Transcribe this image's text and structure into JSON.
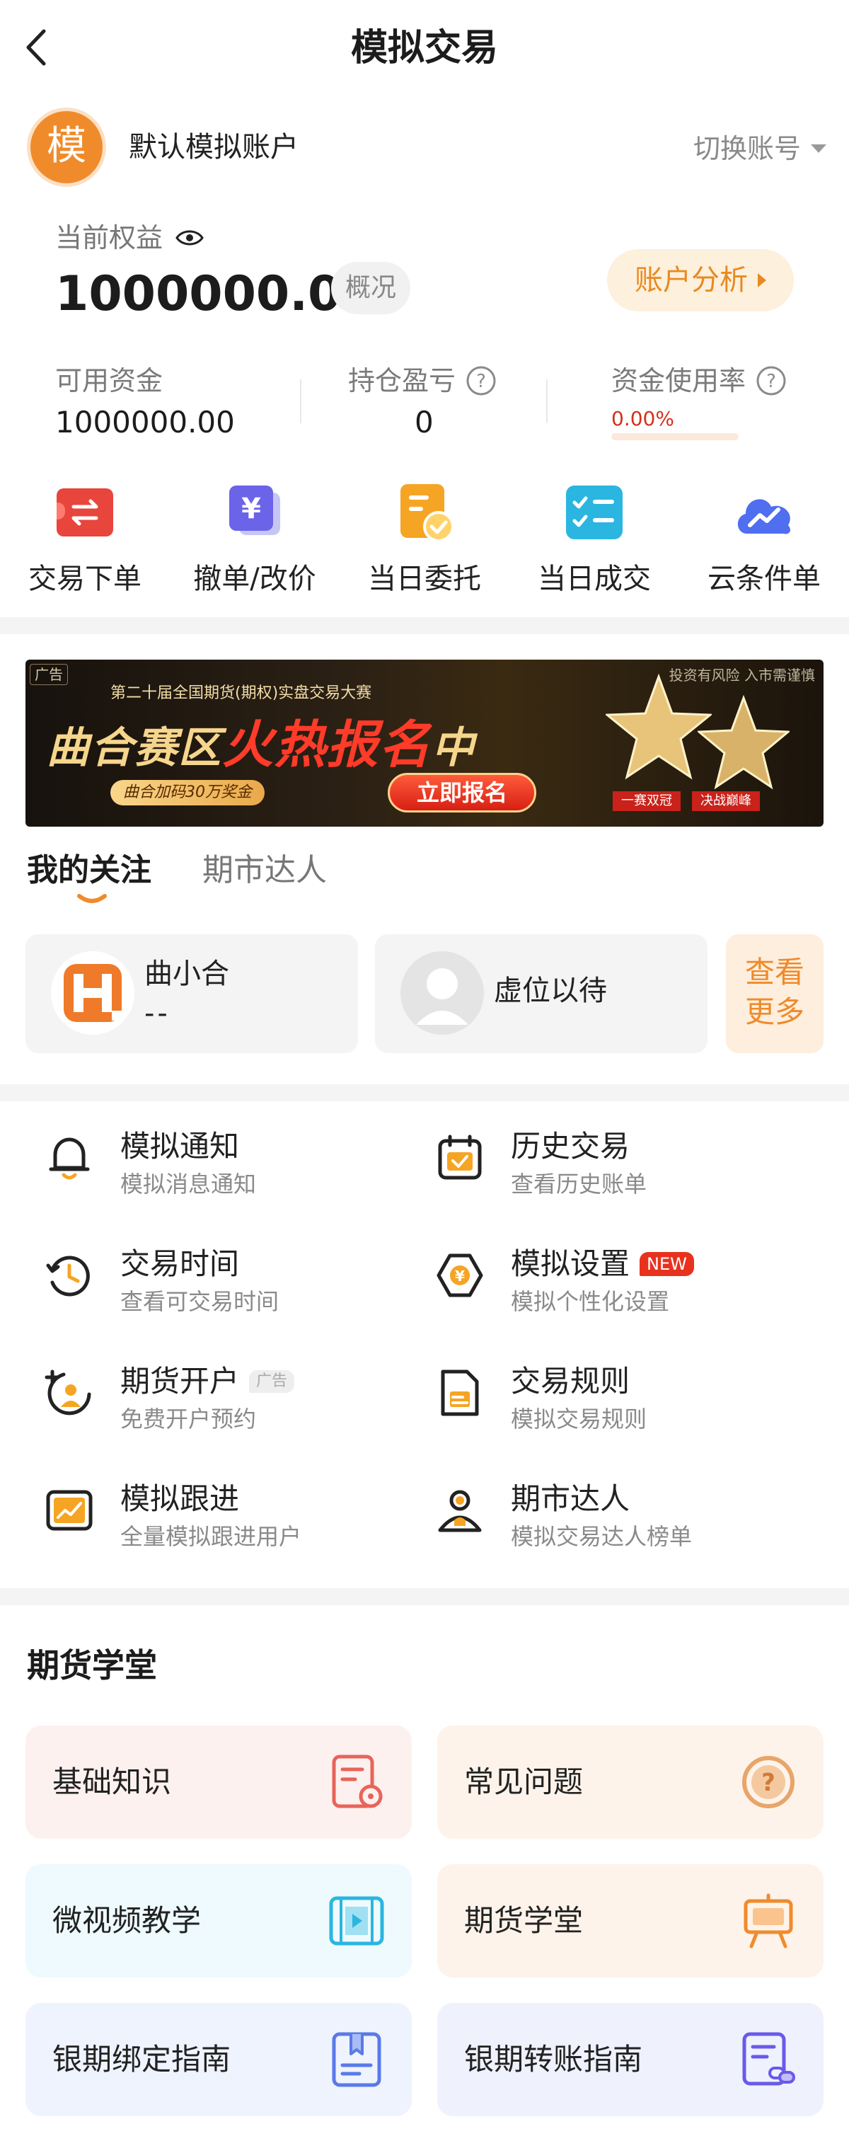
{
  "header": {
    "title": "模拟交易"
  },
  "account": {
    "avatar_char": "模",
    "name": "默认模拟账户",
    "switch_label": "切换账号"
  },
  "equity": {
    "label": "当前权益",
    "value": "1000000.00",
    "overview_label": "概况",
    "analysis_label": "账户分析"
  },
  "stats": [
    {
      "label": "可用资金",
      "value": "1000000.00"
    },
    {
      "label": "持仓盈亏",
      "value": "0"
    },
    {
      "label": "资金使用率",
      "value": "0.00%"
    }
  ],
  "quick_actions": [
    {
      "label": "交易下单",
      "icon": "transfer-icon"
    },
    {
      "label": "撤单/改价",
      "icon": "yuan-card-icon"
    },
    {
      "label": "当日委托",
      "icon": "document-check-icon"
    },
    {
      "label": "当日成交",
      "icon": "checklist-icon"
    },
    {
      "label": "云条件单",
      "icon": "cloud-trend-icon"
    }
  ],
  "banner": {
    "ad_tag": "广告",
    "top_text": "第二十届全国期货(期权)实盘交易大赛",
    "main_prefix": "曲合赛区",
    "main_hot": "火热报名",
    "main_suffix": "中",
    "pill": "曲合加码30万奖金",
    "cta": "立即报名",
    "risk": "投资有风险 入市需谨慎",
    "ribbon_left": "一赛双冠",
    "ribbon_right": "决战巅峰"
  },
  "tabs": [
    {
      "label": "我的关注"
    },
    {
      "label": "期市达人"
    }
  ],
  "follow": {
    "card1_name": "曲小合",
    "card1_value": "--",
    "card2_name": "虚位以待",
    "see_more": [
      "查看",
      "更多"
    ]
  },
  "menu": [
    {
      "title": "模拟通知",
      "sub": "模拟消息通知",
      "icon": "bell-icon"
    },
    {
      "title": "历史交易",
      "sub": "查看历史账单",
      "icon": "calendar-check-icon"
    },
    {
      "title": "交易时间",
      "sub": "查看可交易时间",
      "icon": "clock-icon"
    },
    {
      "title": "模拟设置",
      "sub": "模拟个性化设置",
      "icon": "settings-yuan-icon",
      "badge": "NEW"
    },
    {
      "title": "期货开户",
      "sub": "免费开户预约",
      "icon": "add-user-icon",
      "badge": "广告"
    },
    {
      "title": "交易规则",
      "sub": "模拟交易规则",
      "icon": "rules-doc-icon"
    },
    {
      "title": "模拟跟进",
      "sub": "全量模拟跟进用户",
      "icon": "trend-chart-icon"
    },
    {
      "title": "期市达人",
      "sub": "模拟交易达人榜单",
      "icon": "expert-person-icon"
    }
  ],
  "school": {
    "title": "期货学堂",
    "cards": [
      {
        "label": "基础知识",
        "icon": "doc-search-icon"
      },
      {
        "label": "常见问题",
        "icon": "question-circle-icon"
      },
      {
        "label": "微视频教学",
        "icon": "video-icon"
      },
      {
        "label": "期货学堂",
        "icon": "easel-icon"
      },
      {
        "label": "银期绑定指南",
        "icon": "bookmark-doc-icon"
      },
      {
        "label": "银期转账指南",
        "icon": "link-doc-icon"
      }
    ]
  },
  "colors": {
    "accent_orange": "#f08b2c",
    "danger_red": "#d2321e",
    "text_primary": "#1c1c1c",
    "text_secondary": "#8a8a8a"
  }
}
